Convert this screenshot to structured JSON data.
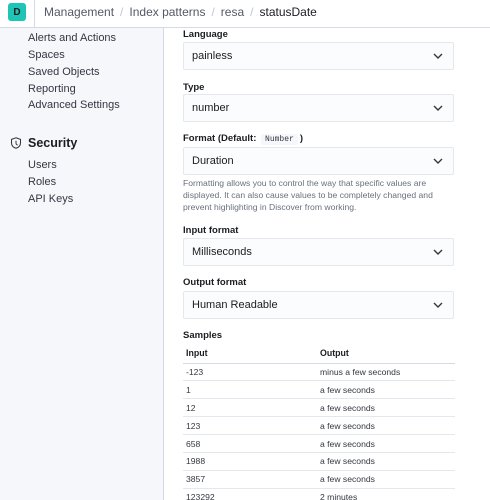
{
  "header": {
    "avatar_letter": "D",
    "breadcrumbs": [
      "Management",
      "Index patterns",
      "resa",
      "statusDate"
    ]
  },
  "sidebar": {
    "kibana_items": [
      "Alerts and Actions",
      "Spaces",
      "Saved Objects",
      "Reporting",
      "Advanced Settings"
    ],
    "security_title": "Security",
    "security_icon": "shield-icon",
    "security_items": [
      "Users",
      "Roles",
      "API Keys"
    ]
  },
  "form": {
    "language_label": "Language",
    "language_value": "painless",
    "type_label": "Type",
    "type_value": "number",
    "format_label_prefix": "Format (Default:",
    "format_default_code": "Number",
    "format_label_suffix": ")",
    "format_value": "Duration",
    "format_help": "Formatting allows you to control the way that specific values are displayed. It can also cause values to be completely changed and prevent highlighting in Discover from working.",
    "input_format_label": "Input format",
    "input_format_value": "Milliseconds",
    "output_format_label": "Output format",
    "output_format_value": "Human Readable"
  },
  "samples": {
    "title": "Samples",
    "columns": [
      "Input",
      "Output"
    ],
    "rows": [
      [
        "-123",
        "minus a few seconds"
      ],
      [
        "1",
        "a few seconds"
      ],
      [
        "12",
        "a few seconds"
      ],
      [
        "123",
        "a few seconds"
      ],
      [
        "658",
        "a few seconds"
      ],
      [
        "1988",
        "a few seconds"
      ],
      [
        "3857",
        "a few seconds"
      ],
      [
        "123292",
        "2 minutes"
      ]
    ]
  }
}
